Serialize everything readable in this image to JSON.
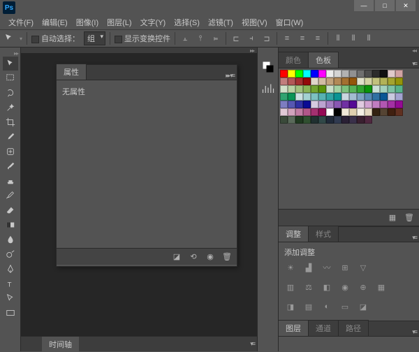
{
  "app": {
    "logo": "Ps"
  },
  "window": {
    "min": "—",
    "max": "□",
    "close": "✕"
  },
  "menu": [
    {
      "label": "文件(F)"
    },
    {
      "label": "编辑(E)"
    },
    {
      "label": "图像(I)"
    },
    {
      "label": "图层(L)"
    },
    {
      "label": "文字(Y)"
    },
    {
      "label": "选择(S)"
    },
    {
      "label": "滤镜(T)"
    },
    {
      "label": "视图(V)"
    },
    {
      "label": "窗口(W)"
    }
  ],
  "options": {
    "auto_select_label": "自动选择：",
    "group_label": "组",
    "show_transform_label": "显示变换控件"
  },
  "properties_panel": {
    "tab": "属性",
    "body": "无属性"
  },
  "timeline": {
    "tab": "时间轴"
  },
  "color_panel": {
    "tab_color": "颜色",
    "tab_swatches": "色板"
  },
  "adjustments_panel": {
    "tab_adjust": "调整",
    "tab_styles": "样式",
    "body_title": "添加调整"
  },
  "layers_panel": {
    "tab_layers": "图层",
    "tab_channels": "通道",
    "tab_paths": "路径"
  },
  "swatch_colors": [
    "#ff0000",
    "#ffff00",
    "#00ff00",
    "#00ffff",
    "#0000ff",
    "#ff00ff",
    "#ececec",
    "#d4d4d4",
    "#b2b2b2",
    "#919191",
    "#6f6f6f",
    "#4d4d4d",
    "#2b2b2b",
    "#111111",
    "#e0caca",
    "#d1a3a3",
    "#c17d7d",
    "#b25757",
    "#a33030",
    "#940a0a",
    "#e0d6ca",
    "#d1bca3",
    "#c1a37d",
    "#b28957",
    "#a37030",
    "#94560a",
    "#e0e0ca",
    "#d1d1a3",
    "#c1c17d",
    "#b2b257",
    "#a3a330",
    "#94940a",
    "#d1e0ca",
    "#b9d1a3",
    "#a1c17d",
    "#89b257",
    "#71a330",
    "#59940a",
    "#cae0ca",
    "#a3d1a3",
    "#7dc17d",
    "#57b257",
    "#30a330",
    "#0a940a",
    "#cae0d6",
    "#a3d1bc",
    "#7dc1a3",
    "#57b289",
    "#30a370",
    "#0a9456",
    "#cae0e0",
    "#a3d1d1",
    "#7dc1c1",
    "#57b2b2",
    "#30a3a3",
    "#0a9494",
    "#cad6e0",
    "#a3bcd1",
    "#7da3c1",
    "#5789b2",
    "#3070a3",
    "#0a5694",
    "#cacae0",
    "#a3a3d1",
    "#7d7dc1",
    "#5757b2",
    "#3030a3",
    "#0a0a94",
    "#d6cae0",
    "#bca3d1",
    "#a37dc1",
    "#8957b2",
    "#7030a3",
    "#560a94",
    "#e0cae0",
    "#d1a3d1",
    "#c17dc1",
    "#b257b2",
    "#a330a3",
    "#940a94",
    "#e0cad6",
    "#d1a3bc",
    "#c17da3",
    "#b25789",
    "#a33070",
    "#940a56",
    "#ffffff",
    "#000000",
    "#f0e8d8",
    "#e0d0b0",
    "#f5f0e5",
    "#e5d8c0",
    "#332211",
    "#554433",
    "#402010",
    "#603020",
    "#3a4a3a",
    "#5a6a5a",
    "#203a20",
    "#305030",
    "#203030",
    "#304848",
    "#202a3a",
    "#303a50",
    "#2a2035",
    "#3a304a",
    "#3a2030",
    "#502840"
  ]
}
